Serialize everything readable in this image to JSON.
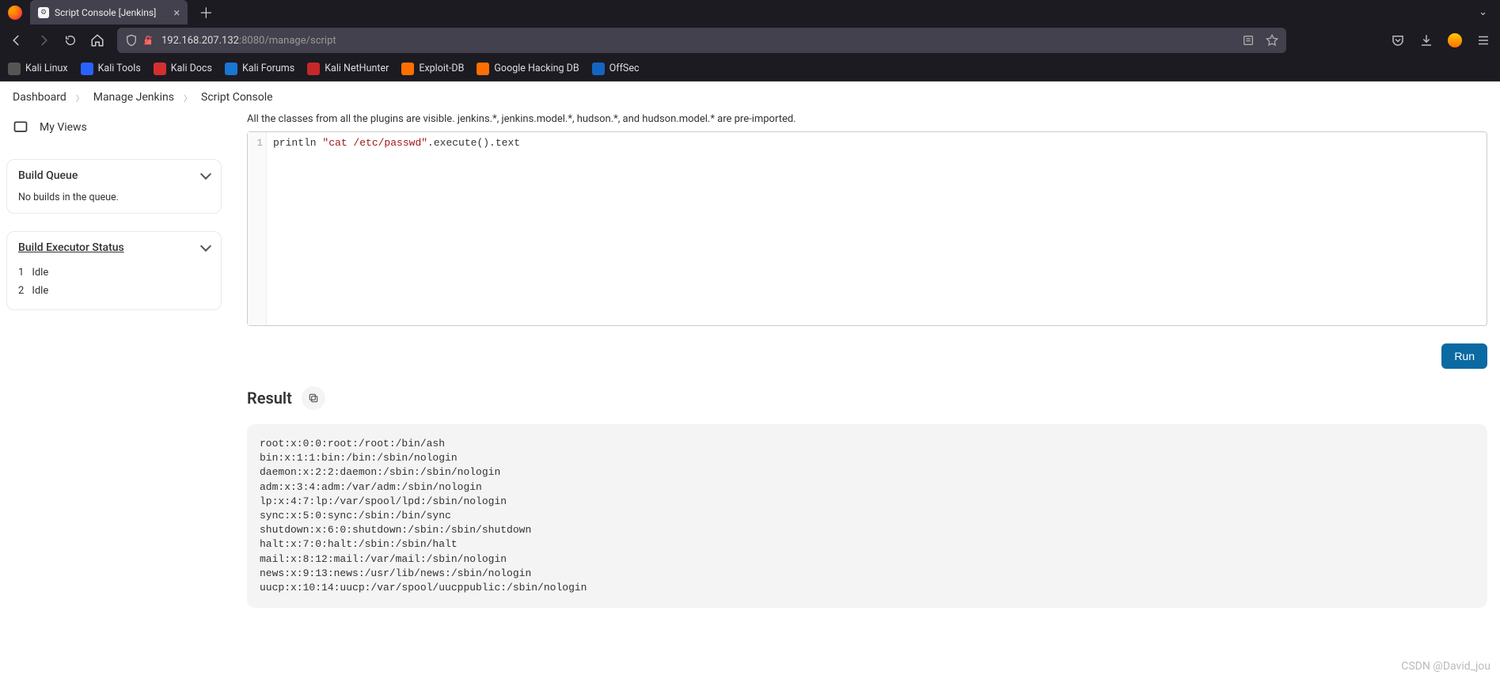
{
  "browser": {
    "tab_title": "Script Console [Jenkins]",
    "url_display_prefix": "192.168.207.132",
    "url_display_suffix": ":8080/manage/script"
  },
  "bookmarks": [
    {
      "label": "Kali Linux",
      "color": "#555"
    },
    {
      "label": "Kali Tools",
      "color": "#2962ff"
    },
    {
      "label": "Kali Docs",
      "color": "#d32f2f"
    },
    {
      "label": "Kali Forums",
      "color": "#1976d2"
    },
    {
      "label": "Kali NetHunter",
      "color": "#c62828"
    },
    {
      "label": "Exploit-DB",
      "color": "#ff6f00"
    },
    {
      "label": "Google Hacking DB",
      "color": "#ff6f00"
    },
    {
      "label": "OffSec",
      "color": "#1565c0"
    }
  ],
  "breadcrumbs": [
    "Dashboard",
    "Manage Jenkins",
    "Script Console"
  ],
  "sidebar": {
    "my_views": "My Views",
    "build_queue": {
      "title": "Build Queue",
      "empty": "No builds in the queue."
    },
    "executor": {
      "title": "Build Executor Status",
      "rows": [
        {
          "num": "1",
          "state": "Idle"
        },
        {
          "num": "2",
          "state": "Idle"
        }
      ]
    }
  },
  "main": {
    "partial_text": "All the classes from all the plugins are visible. jenkins.*, jenkins.model.*, hudson.*, and hudson.model.* are pre-imported.",
    "line_no": "1",
    "code_plain1": "println ",
    "code_str": "\"cat /etc/passwd\"",
    "code_plain2": ".execute().text",
    "run_label": "Run",
    "result_title": "Result",
    "result_output": "root:x:0:0:root:/root:/bin/ash\nbin:x:1:1:bin:/bin:/sbin/nologin\ndaemon:x:2:2:daemon:/sbin:/sbin/nologin\nadm:x:3:4:adm:/var/adm:/sbin/nologin\nlp:x:4:7:lp:/var/spool/lpd:/sbin/nologin\nsync:x:5:0:sync:/sbin:/bin/sync\nshutdown:x:6:0:shutdown:/sbin:/sbin/shutdown\nhalt:x:7:0:halt:/sbin:/sbin/halt\nmail:x:8:12:mail:/var/mail:/sbin/nologin\nnews:x:9:13:news:/usr/lib/news:/sbin/nologin\nuucp:x:10:14:uucp:/var/spool/uucppublic:/sbin/nologin"
  },
  "watermark": "CSDN @David_jou"
}
